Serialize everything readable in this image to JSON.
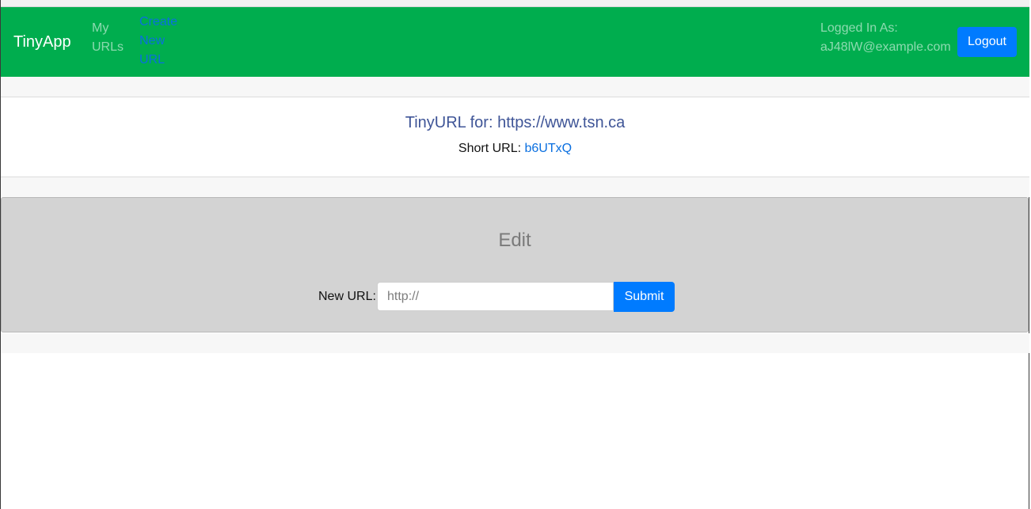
{
  "navbar": {
    "brand": "TinyApp",
    "links": [
      {
        "label": "My URLs"
      },
      {
        "label": "Create New URL"
      }
    ],
    "logged_in_label": "Logged In As:",
    "user_email": "aJ48lW@example.com",
    "logout_label": "Logout"
  },
  "url_info": {
    "title": "TinyURL for: https://www.tsn.ca",
    "short_url_label": "Short URL:",
    "short_url_code": "b6UTxQ"
  },
  "edit": {
    "title": "Edit",
    "new_url_label": "New URL:",
    "input_placeholder": "http://",
    "input_value": "",
    "submit_label": "Submit"
  },
  "colors": {
    "navbar_bg": "#00ad4e",
    "primary_button": "#007bff",
    "panel_bg": "#d3d3d3"
  }
}
